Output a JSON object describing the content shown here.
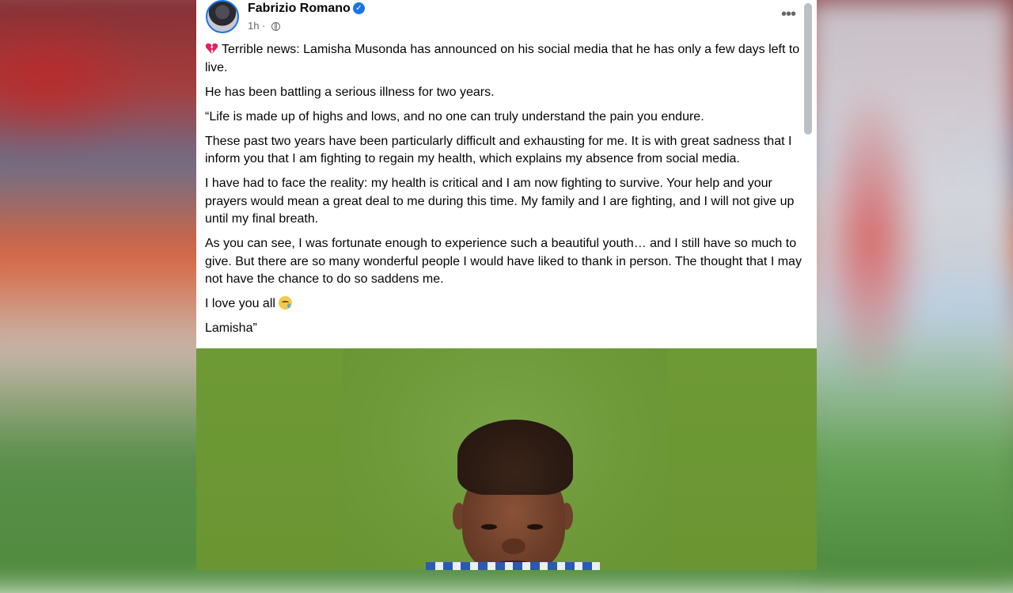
{
  "post": {
    "author": "Fabrizio Romano",
    "verified_icon": "verified-badge-icon",
    "time": "1h",
    "privacy_icon": "globe-icon",
    "separator": "·",
    "more_label": "•••",
    "paragraphs": [
      "Terrible news: Lamisha Musonda has announced on his social media that he has only a few days left to live.",
      "He has been battling a serious illness for two years.",
      "“Life is made up of highs and lows, and no one can truly understand the pain you endure.",
      "These past two years have been particularly difficult and exhausting for me. It is with great sadness that I inform you that I am fighting to regain my health, which explains my absence from social media.",
      "I have had to face the reality: my health is critical and I am now fighting to survive. Your help and your prayers would mean a great deal to me during this time. My family and I are fighting, and I will not give up until my final breath.",
      "As you can see, I was fortunate enough to experience such a beautiful youth… and I still have so much to give. But there are so many wonderful people I would have liked to thank in person. The thought that I may not have the chance to do so saddens me.",
      "I love you all",
      "Lamisha”"
    ]
  },
  "colors": {
    "accent": "#1b74e4",
    "text": "#050505",
    "muted": "#65676b"
  }
}
